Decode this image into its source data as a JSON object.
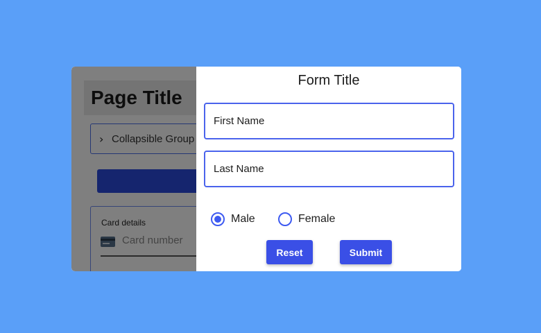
{
  "background_page": {
    "title": "Page Title",
    "collapsible_label": "Collapsible Group",
    "card": {
      "label": "Card details",
      "number_placeholder": "Card number",
      "icon": "credit-card-icon"
    },
    "collapsible_icon": "chevron-right-icon"
  },
  "form": {
    "title": "Form Title",
    "first_name": {
      "value": "",
      "placeholder": "First Name"
    },
    "last_name": {
      "value": "",
      "placeholder": "Last Name"
    },
    "gender": {
      "options": [
        {
          "label": "Male",
          "selected": true
        },
        {
          "label": "Female",
          "selected": false
        }
      ]
    },
    "buttons": {
      "reset_label": "Reset",
      "submit_label": "Submit"
    }
  },
  "colors": {
    "page_background": "#5a9ff8",
    "accent": "#3a4fe6",
    "overlay": "rgba(0,0,0,0.5)"
  }
}
